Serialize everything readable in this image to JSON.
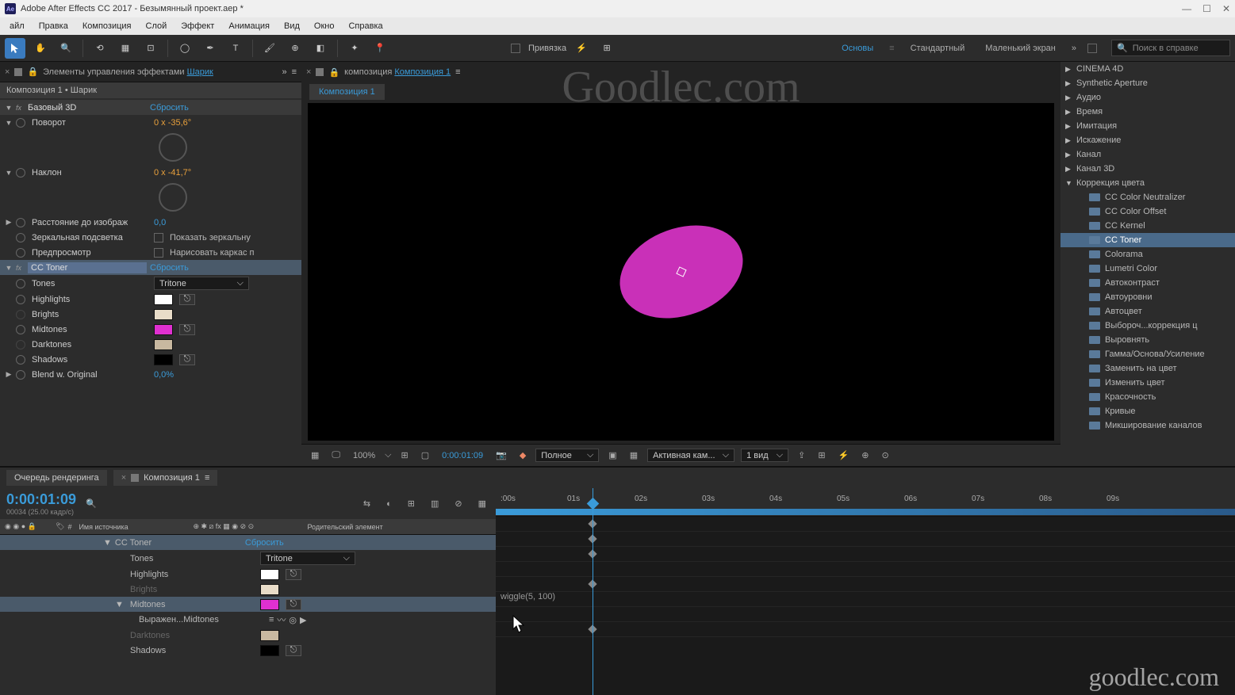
{
  "title": "Adobe After Effects CC 2017 - Безымянный проект.aep *",
  "menu": [
    "айл",
    "Правка",
    "Композиция",
    "Слой",
    "Эффект",
    "Анимация",
    "Вид",
    "Окно",
    "Справка"
  ],
  "toolbar": {
    "snap": "Привязка",
    "workspaces": [
      "Основы",
      "Стандартный",
      "Маленький экран"
    ],
    "search_placeholder": "Поиск в справке"
  },
  "effectsPanel": {
    "tab": "Элементы управления эффектами",
    "tabLink": "Шарик",
    "path": "Композиция 1 • Шарик",
    "fx1": {
      "name": "Базовый 3D",
      "reset": "Сбросить",
      "props": {
        "rotation": "Поворот",
        "rotation_val": "0 x -35,6°",
        "tilt": "Наклон",
        "tilt_val": "0 x -41,7°",
        "distance": "Расстояние до изображ",
        "distance_val": "0,0",
        "specular": "Зеркальная подсветка",
        "show_specular": "Показать зеркальну",
        "preview": "Предпросмотр",
        "wireframe": "Нарисовать каркас п"
      }
    },
    "fx2": {
      "name": "CC Toner",
      "reset": "Сбросить",
      "tones": "Tones",
      "tones_val": "Tritone",
      "highlights": "Highlights",
      "brights": "Brights",
      "midtones": "Midtones",
      "darktones": "Darktones",
      "shadows": "Shadows",
      "blend": "Blend w. Original",
      "blend_val": "0,0%"
    }
  },
  "compPanel": {
    "tab": "композиция",
    "tabLink": "Композиция 1",
    "subtab": "Композиция 1",
    "footer": {
      "zoom": "100%",
      "time": "0:00:01:09",
      "quality": "Полное",
      "camera": "Активная кам...",
      "views": "1 вид"
    }
  },
  "effectsBrowser": {
    "cats": [
      "CINEMA 4D",
      "Synthetic Aperture",
      "Аудио",
      "Время",
      "Имитация",
      "Искажение",
      "Канал",
      "Канал 3D"
    ],
    "openCat": "Коррекция цвета",
    "items": [
      "CC Color Neutralizer",
      "CC Color Offset",
      "CC Kernel",
      "CC Toner",
      "Colorama",
      "Lumetri Color",
      "Автоконтраст",
      "Автоуровни",
      "Автоцвет",
      "Выбороч...коррекция ц",
      "Выровнять",
      "Гамма/Основа/Усиление",
      "Заменить на цвет",
      "Изменить цвет",
      "Красочность",
      "Кривые",
      "Микширование каналов"
    ]
  },
  "timeline": {
    "renderTab": "Очередь рендеринга",
    "compTab": "Композиция 1",
    "timecode": "0:00:01:09",
    "timecode_sub": "00034 (25.00 кадр/с)",
    "sourceHeader": "Имя источника",
    "parentHeader": "Родительский элемент",
    "ruler": [
      ":00s",
      "01s",
      "02s",
      "03s",
      "04s",
      "05s",
      "06s",
      "07s",
      "08s",
      "09s"
    ],
    "layer": {
      "fx": "CC Toner",
      "reset": "Сбросить",
      "tones": "Tones",
      "tones_val": "Tritone",
      "highlights": "Highlights",
      "brights": "Brights",
      "midtones": "Midtones",
      "expr": "Выражен...Midtones",
      "darktones": "Darktones",
      "shadows": "Shadows",
      "expression": "wiggle(5, 100)"
    }
  },
  "watermark": "Goodlec.com",
  "watermark2": "goodlec.com"
}
